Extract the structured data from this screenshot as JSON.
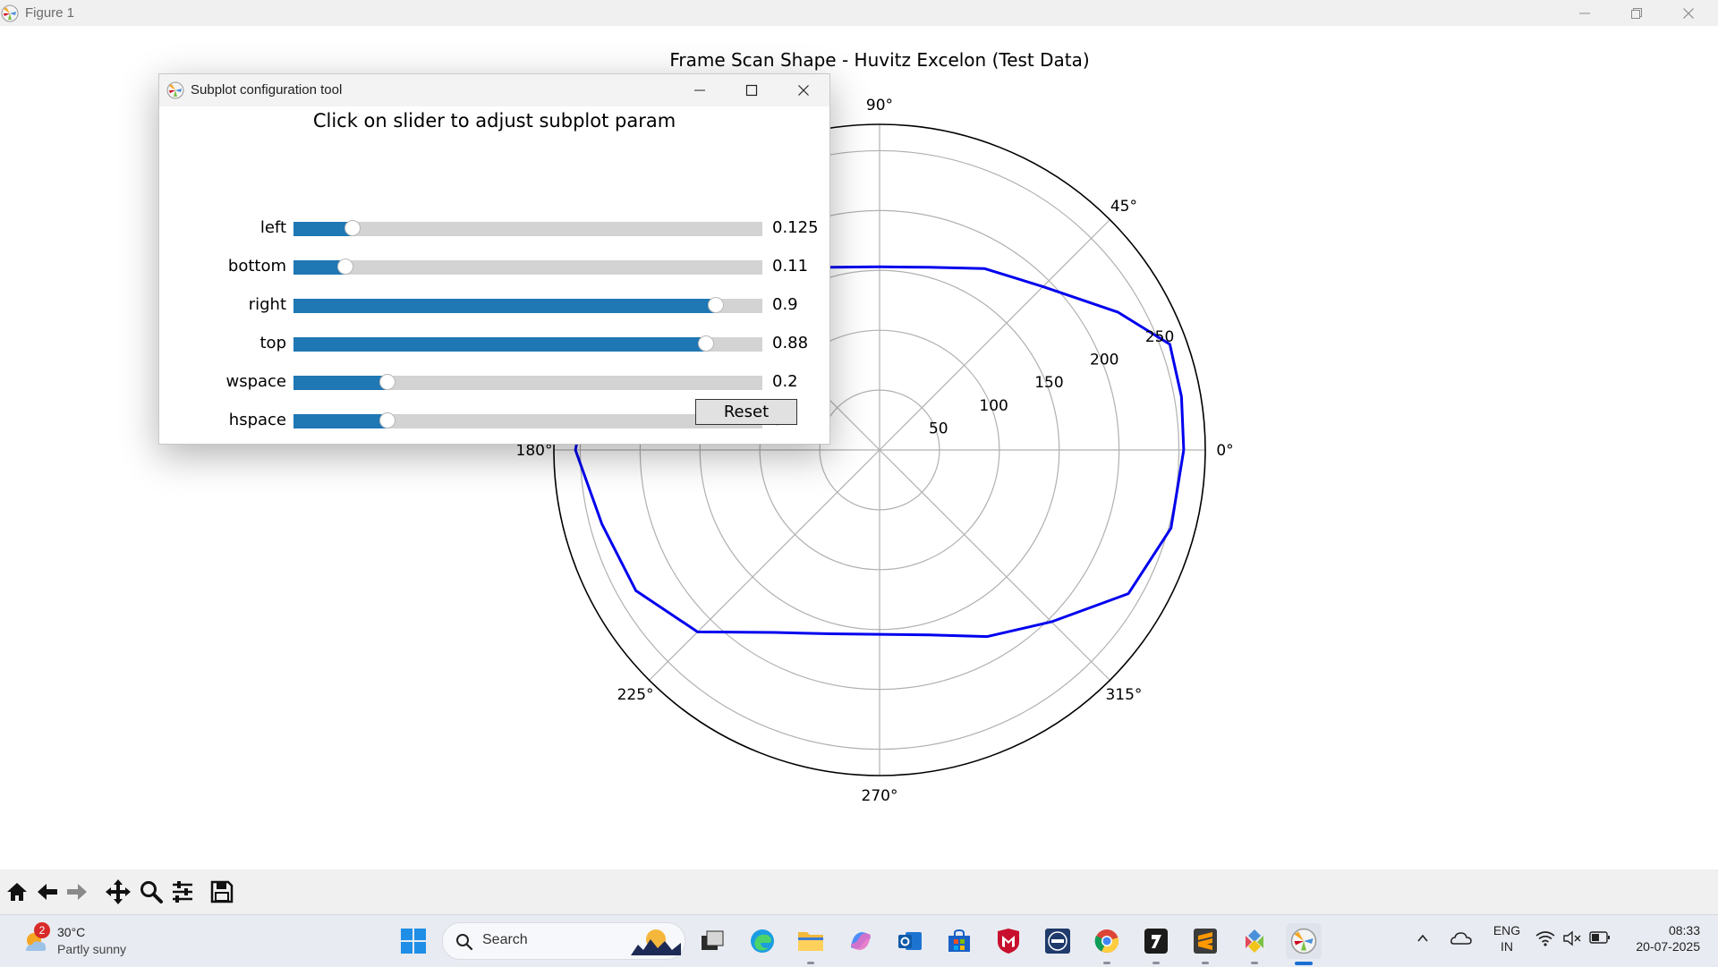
{
  "window": {
    "title": "Figure 1"
  },
  "figure": {
    "title": "Frame Scan Shape - Huvitz Excelon (Test Data)",
    "angle_labels": [
      {
        "deg": 0,
        "label": "0°"
      },
      {
        "deg": 45,
        "label": "45°"
      },
      {
        "deg": 90,
        "label": "90°"
      },
      {
        "deg": 180,
        "label": "180°"
      },
      {
        "deg": 225,
        "label": "225°"
      },
      {
        "deg": 270,
        "label": "270°"
      },
      {
        "deg": 315,
        "label": "315°"
      }
    ],
    "radial_ticks": [
      {
        "value": 50,
        "label": "50"
      },
      {
        "value": 100,
        "label": "100"
      },
      {
        "value": 150,
        "label": "150"
      },
      {
        "value": 200,
        "label": "200"
      },
      {
        "value": 250,
        "label": "250"
      }
    ]
  },
  "chart_data": {
    "type": "polar-line",
    "title": "Frame Scan Shape - Huvitz Excelon (Test Data)",
    "r_max": 272,
    "angular_ticks_deg": [
      0,
      45,
      90,
      135,
      180,
      225,
      270,
      315
    ],
    "line_color": "#0000ee",
    "series": [
      {
        "points": [
          {
            "theta": 0,
            "r": 254
          },
          {
            "theta": 10,
            "r": 256
          },
          {
            "theta": 20,
            "r": 258
          },
          {
            "theta": 30,
            "r": 230
          },
          {
            "theta": 45,
            "r": 193
          },
          {
            "theta": 60,
            "r": 175
          },
          {
            "theta": 75,
            "r": 158
          },
          {
            "theta": 90,
            "r": 153
          },
          {
            "theta": 105,
            "r": 158
          },
          {
            "theta": 120,
            "r": 175
          },
          {
            "theta": 135,
            "r": 205
          },
          {
            "theta": 150,
            "r": 235
          },
          {
            "theta": 165,
            "r": 250
          },
          {
            "theta": 180,
            "r": 254
          },
          {
            "theta": 195,
            "r": 240
          },
          {
            "theta": 210,
            "r": 235
          },
          {
            "theta": 225,
            "r": 215
          },
          {
            "theta": 240,
            "r": 176
          },
          {
            "theta": 255,
            "r": 159
          },
          {
            "theta": 270,
            "r": 154
          },
          {
            "theta": 285,
            "r": 160
          },
          {
            "theta": 300,
            "r": 180
          },
          {
            "theta": 315,
            "r": 203
          },
          {
            "theta": 330,
            "r": 240
          },
          {
            "theta": 345,
            "r": 252
          },
          {
            "theta": 360,
            "r": 254
          }
        ]
      }
    ]
  },
  "dialog": {
    "title": "Subplot configuration tool",
    "heading": "Click on slider to adjust subplot param",
    "sliders": [
      {
        "label": "left",
        "value": 0.125,
        "display": "0.125"
      },
      {
        "label": "bottom",
        "value": 0.11,
        "display": "0.11"
      },
      {
        "label": "right",
        "value": 0.9,
        "display": "0.9"
      },
      {
        "label": "top",
        "value": 0.88,
        "display": "0.88"
      },
      {
        "label": "wspace",
        "value": 0.2,
        "display": "0.2"
      },
      {
        "label": "hspace",
        "value": 0.2,
        "display": "0.2"
      }
    ],
    "reset_label": "Reset",
    "accent_color": "#1f77b4"
  },
  "toolbar": {
    "items": [
      "home-icon",
      "back-icon",
      "forward-icon",
      "pan-icon",
      "zoom-icon",
      "configure-subplots-icon",
      "save-icon"
    ]
  },
  "taskbar": {
    "weather": {
      "temp": "30°C",
      "condition": "Partly sunny",
      "badge": "2"
    },
    "search_placeholder": "Search",
    "tray": {
      "lang1": "ENG",
      "lang2": "IN",
      "time": "08:33",
      "date": "20-07-2025"
    }
  }
}
